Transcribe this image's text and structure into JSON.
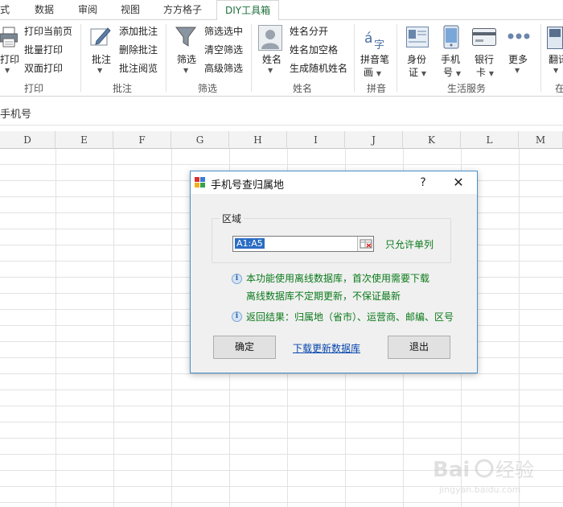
{
  "tabs": [
    {
      "label": "式"
    },
    {
      "label": "数据"
    },
    {
      "label": "审阅"
    },
    {
      "label": "视图"
    },
    {
      "label": "方方格子"
    },
    {
      "label": "DIY工具箱",
      "active": true
    }
  ],
  "ribbon": {
    "print": {
      "big": "打印",
      "items": [
        "打印当前页",
        "批量打印",
        "双面打印"
      ],
      "label": "打印"
    },
    "comment": {
      "big": "批注",
      "items": [
        "添加批注",
        "删除批注",
        "批注阅览"
      ],
      "label": "批注"
    },
    "filter": {
      "big": "筛选",
      "items": [
        "筛选选中",
        "清空筛选",
        "高级筛选"
      ],
      "label": "筛选"
    },
    "name": {
      "big": "姓名",
      "items": [
        "姓名分开",
        "姓名加空格",
        "生成随机姓名"
      ],
      "label": "姓名"
    },
    "pinyin": {
      "big_line1": "拼音笔",
      "big_line2": "画",
      "label": "拼音"
    },
    "life": {
      "id_line1": "身份",
      "id_line2": "证",
      "phone_line1": "手机",
      "phone_line2": "号",
      "bank_line1": "银行",
      "bank_line2": "卡",
      "more": "更多",
      "label": "生活服务"
    },
    "translate": {
      "big": "翻译",
      "label": "在"
    }
  },
  "formula_bar": {
    "name_box": "手机号"
  },
  "columns": [
    "D",
    "E",
    "F",
    "G",
    "H",
    "I",
    "J",
    "K",
    "L",
    "M"
  ],
  "dialog": {
    "title": "手机号查归属地",
    "help": "?",
    "close": "✕",
    "group_label": "区域",
    "range_value": "A1:A5",
    "only_single_col": "只允许单列",
    "note1_line1": "本功能使用离线数据库，首次使用需要下载",
    "note1_line2": "离线数据库不定期更新，不保证最新",
    "note2": "返回结果：归属地（省市）、运营商、邮编、区号",
    "ok": "确定",
    "download_link": "下载更新数据库",
    "exit": "退出"
  },
  "colors": {
    "accent_green": "#1e6f3c",
    "note_green": "#0a7a1a",
    "link_blue": "#0645ad",
    "dialog_border": "#4a90c8",
    "selection_blue": "#2b6cc4"
  }
}
